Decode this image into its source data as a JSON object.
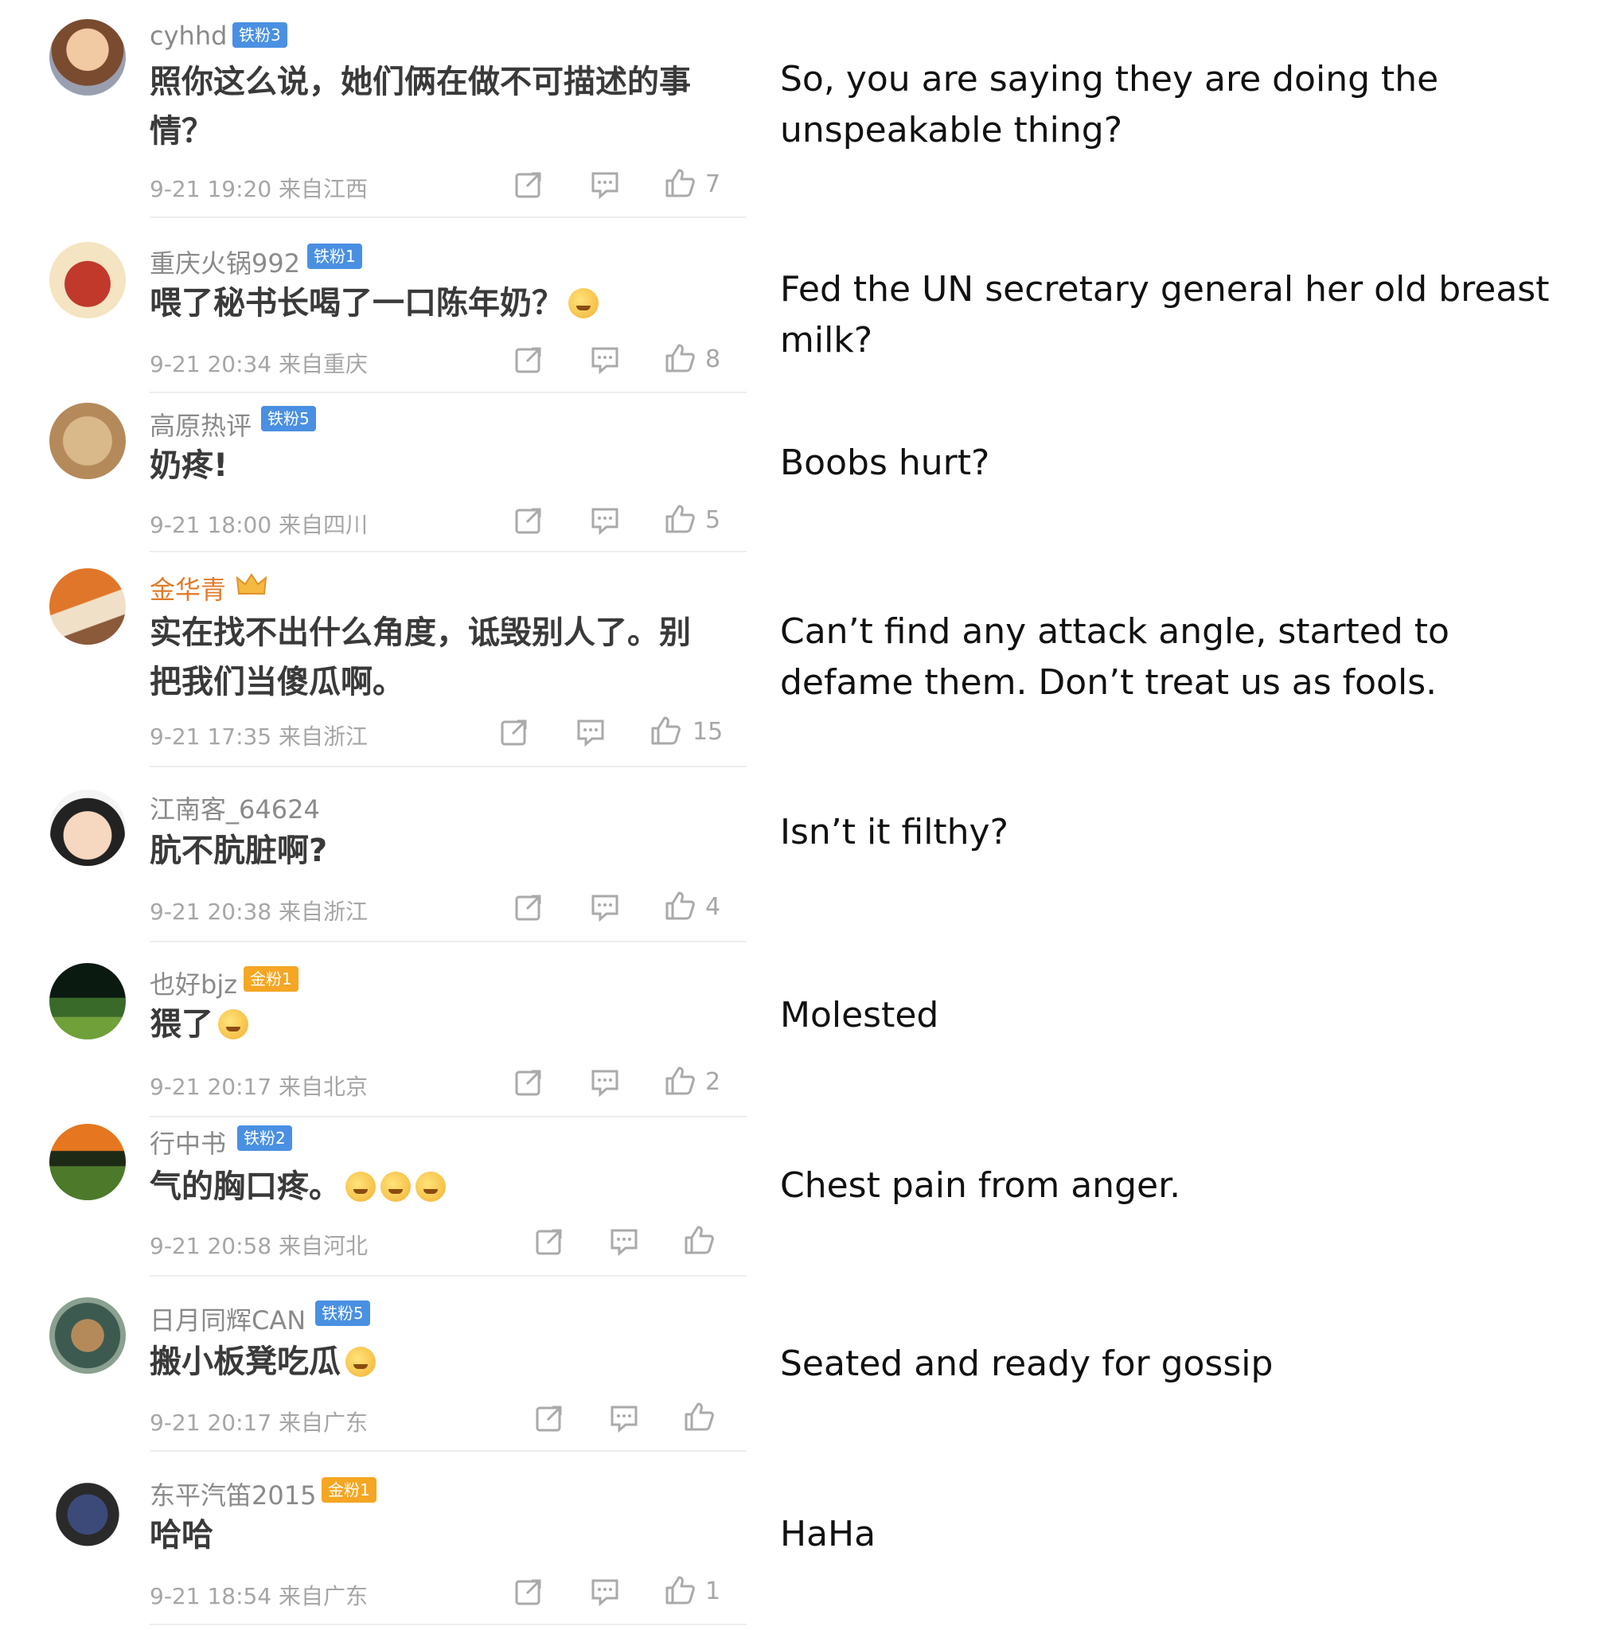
{
  "comments": [
    {
      "username": "cyhhd",
      "badge": "铁粉3",
      "badge_color": "#4a90e2",
      "text": "照你这么说，她们俩在做不可描述的事情？",
      "meta": "9-21 19:20 来自江西",
      "likes": "7",
      "translation": "So, you are saying they are doing the unspeakable thing?"
    },
    {
      "username": "重庆火锅992",
      "badge": "铁粉1",
      "badge_color": "#4a90e2",
      "text": "喂了秘书长喝了一口陈年奶？",
      "meta": "9-21 20:34 来自重庆",
      "likes": "8",
      "translation": "Fed the UN secretary general her old breast milk?"
    },
    {
      "username": "高原热评",
      "badge": "铁粉5",
      "badge_color": "#4a90e2",
      "text": "奶疼!",
      "meta": "9-21 18:00 来自四川",
      "likes": "5",
      "translation": "Boobs hurt?"
    },
    {
      "username": "金华青",
      "badge": "",
      "badge_color": "#f5a623",
      "text": "实在找不出什么角度，诋毁别人了。别把我们当傻瓜啊。",
      "meta": "9-21 17:35 来自浙江",
      "likes": "15",
      "translation": "Can’t find any attack angle, started to defame them. Don’t treat us as fools."
    },
    {
      "username": "江南客_64624",
      "badge": "",
      "badge_color": "",
      "text": "肮不肮脏啊?",
      "meta": "9-21 20:38 来自浙江",
      "likes": "4",
      "translation": "Isn’t it filthy?"
    },
    {
      "username": "也好bjz",
      "badge": "金粉1",
      "badge_color": "#f5a623",
      "text": "猥了",
      "meta": "9-21 20:17 来自北京",
      "likes": "2",
      "translation": "Molested"
    },
    {
      "username": "行中书",
      "badge": "铁粉2",
      "badge_color": "#4a90e2",
      "text": "气的胸口疼。",
      "meta": "9-21 20:58 来自河北",
      "likes": "",
      "translation": "Chest pain from anger."
    },
    {
      "username": "日月同辉CAN",
      "badge": "铁粉5",
      "badge_color": "#4a90e2",
      "text": "搬小板凳吃瓜",
      "meta": "9-21 20:17 来自广东",
      "likes": "",
      "translation": "Seated and ready for gossip"
    },
    {
      "username": "东平汽笛2015",
      "badge": "金粉1",
      "badge_color": "#f5a623",
      "text": "哈哈",
      "meta": "9-21 18:54 来自广东",
      "likes": "1",
      "translation": "HaHa"
    }
  ],
  "icons": {
    "share": "share-icon",
    "comment": "comment-icon",
    "like": "thumbs-up-icon"
  }
}
